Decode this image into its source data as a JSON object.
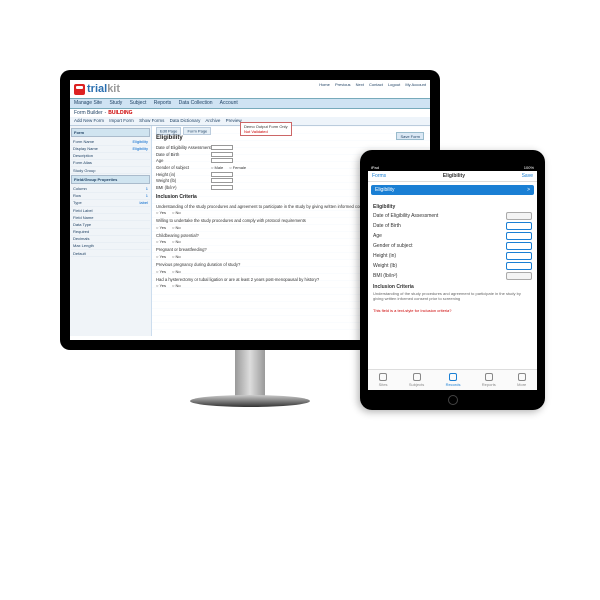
{
  "brand": {
    "part1": "trial",
    "part2": "kit"
  },
  "monitor": {
    "topright": [
      "Home",
      "Previous",
      "Next",
      "Contact",
      "Logout",
      "My Account"
    ],
    "menu": [
      "Manage Site",
      "Study",
      "Subject",
      "Reports",
      "Data Collection",
      "Account"
    ],
    "formBuilderLabel": "Form Builder",
    "building": "BUILDING",
    "badge": {
      "title": "Demo Output Form Only",
      "sub": "Not Validated"
    },
    "toolbar": [
      "Add New Form",
      "Import Form",
      "Show Forms",
      "Data Dictionary",
      "Archive",
      "Preview"
    ],
    "saveBtn": "Save Form",
    "sideFormHeader": "Form",
    "sideFormRows": [
      {
        "k": "Form Name",
        "v": "Eligibility"
      },
      {
        "k": "Display Name",
        "v": "Eligibility"
      },
      {
        "k": "Description",
        "v": ""
      },
      {
        "k": "Form Alias",
        "v": ""
      },
      {
        "k": "Study Group",
        "v": ""
      }
    ],
    "sidePropsHeader": "Field/Group Properties",
    "sidePropsRows": [
      {
        "k": "Column",
        "v": "1"
      },
      {
        "k": "Row",
        "v": "1"
      },
      {
        "k": "Type",
        "v": "label"
      },
      {
        "k": "Field Label",
        "v": ""
      },
      {
        "k": "Field Name",
        "v": ""
      },
      {
        "k": "Data Type",
        "v": ""
      },
      {
        "k": "Required",
        "v": ""
      },
      {
        "k": "Decimals",
        "v": ""
      },
      {
        "k": "Max Length",
        "v": ""
      },
      {
        "k": "Default",
        "v": ""
      }
    ],
    "tabs": [
      "Edit Page",
      "Form Page"
    ],
    "formTitle": "Eligibility",
    "fields": [
      {
        "label": "Date of Eligibility Assessment",
        "type": "date"
      },
      {
        "label": "Date of Birth",
        "type": "date"
      },
      {
        "label": "Age",
        "type": "num"
      },
      {
        "label": "Gender of subject",
        "type": "radio",
        "opts": [
          "Male",
          "Female"
        ]
      },
      {
        "label": "Height (in)",
        "type": "num"
      },
      {
        "label": "Weight (lb)",
        "type": "num"
      },
      {
        "label": "BMI (lb/in²)",
        "type": "num"
      }
    ],
    "inclusionHeader": "Inclusion Criteria",
    "inclusionIntro": "Understanding of the study procedures and agreement to participate in the study by giving written informed consent prior to screening",
    "q1": "Willing to undertake the study procedures and comply with protocol requirements",
    "q2": "Childbearing potential?",
    "q3": "Pregnant or breastfeeding?",
    "q4": "Previous pregnancy during duration of study?",
    "q5": "Had a hysterectomy or tubal ligation or are at least 2 years post-menopausal by history?",
    "yesNo": [
      "Yes",
      "No"
    ]
  },
  "tablet": {
    "statusL": "iPad",
    "statusR": "100%",
    "navBack": "Forms",
    "navTitle": "Eligibility",
    "navSave": "Save",
    "blueL": "Eligibility",
    "blueR": ">",
    "section": "Eligibility",
    "fields": [
      {
        "label": "Date of Eligibility Assessment",
        "box": "g"
      },
      {
        "label": "Date of Birth",
        "box": "b"
      },
      {
        "label": "Age",
        "box": "b"
      },
      {
        "label": "Gender of subject",
        "box": "b"
      },
      {
        "label": "Height (in)",
        "box": "b"
      },
      {
        "label": "Weight (lb)",
        "box": "b"
      },
      {
        "label": "BMI (lb/in²)",
        "box": "g"
      }
    ],
    "incHdr": "Inclusion Criteria",
    "incTxt": "Understanding of the study procedures and agreement to participate in the study by giving written informed consent prior to screening",
    "redTxt": "This field is a text-style for Inclusion criteria?",
    "bottombar": [
      {
        "label": "Sites"
      },
      {
        "label": "Subjects"
      },
      {
        "label": "Records",
        "active": true
      },
      {
        "label": "Reports"
      },
      {
        "label": "More"
      }
    ]
  }
}
